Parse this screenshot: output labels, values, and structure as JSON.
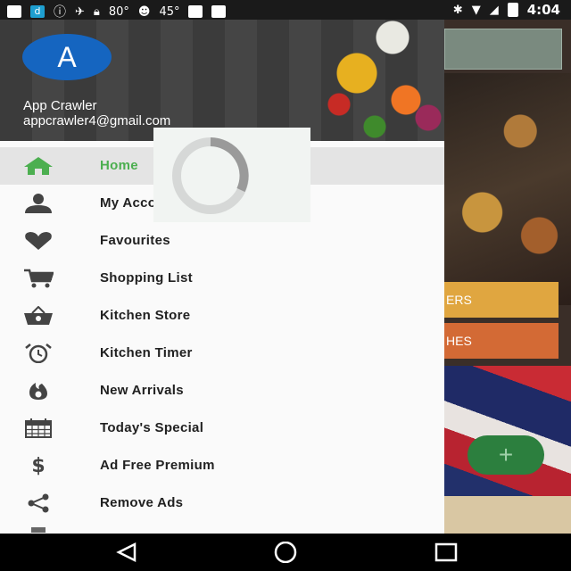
{
  "status_bar": {
    "temp1": "80°",
    "temp2": "45°",
    "time": "4:04"
  },
  "drawer": {
    "avatar_letter": "A",
    "user_name": "App Crawler",
    "user_email": "appcrawler4@gmail.com",
    "items": [
      {
        "label": "Home",
        "icon": "home-icon"
      },
      {
        "label": "My Account",
        "icon": "person-icon"
      },
      {
        "label": "Favourites",
        "icon": "heart-icon"
      },
      {
        "label": "Shopping List",
        "icon": "cart-icon"
      },
      {
        "label": "Kitchen Store",
        "icon": "basket-icon"
      },
      {
        "label": "Kitchen Timer",
        "icon": "alarm-clock-icon"
      },
      {
        "label": "New Arrivals",
        "icon": "flame-icon"
      },
      {
        "label": "Today's Special",
        "icon": "calendar-icon"
      },
      {
        "label": "Ad Free Premium",
        "icon": "dollar-icon"
      },
      {
        "label": "Remove Ads",
        "icon": "share-icon"
      }
    ]
  },
  "background_app": {
    "button1_label": "ERS",
    "button2_label": "HES",
    "fab_label": "+"
  },
  "colors": {
    "accent": "#4caf50",
    "avatar": "#1565c0",
    "button_yellow": "#e0a640",
    "button_orange": "#d36a35"
  }
}
